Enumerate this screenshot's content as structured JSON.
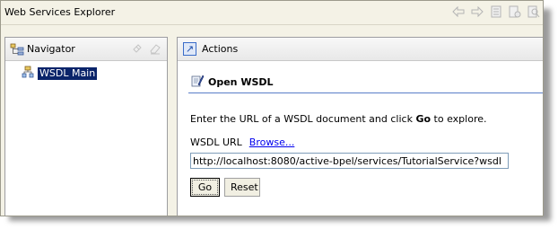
{
  "window": {
    "title": "Web Services Explorer"
  },
  "toolbar": {
    "icons": [
      "back-arrow-icon",
      "forward-arrow-icon",
      "document-icon",
      "document-settings-icon",
      "search-document-icon"
    ]
  },
  "navigator": {
    "header_label": "Navigator",
    "tree": [
      {
        "label": "WSDL Main",
        "selected": true,
        "icon": "tree-hierarchy-icon"
      }
    ]
  },
  "actions": {
    "header_label": "Actions",
    "section_title": "Open WSDL",
    "instructions_prefix": "Enter the URL of a WSDL document and click",
    "instructions_bold": "Go",
    "instructions_suffix": "to explore.",
    "url_label": "WSDL URL",
    "browse_link": "Browse...",
    "url_value": "http://localhost:8080/active-bpel/services/TutorialService?wsdl",
    "go_button": "Go",
    "reset_button": "Reset"
  },
  "colors": {
    "selection": "#0a246a",
    "link": "#0000ee",
    "frame": "#f4f2e6"
  }
}
